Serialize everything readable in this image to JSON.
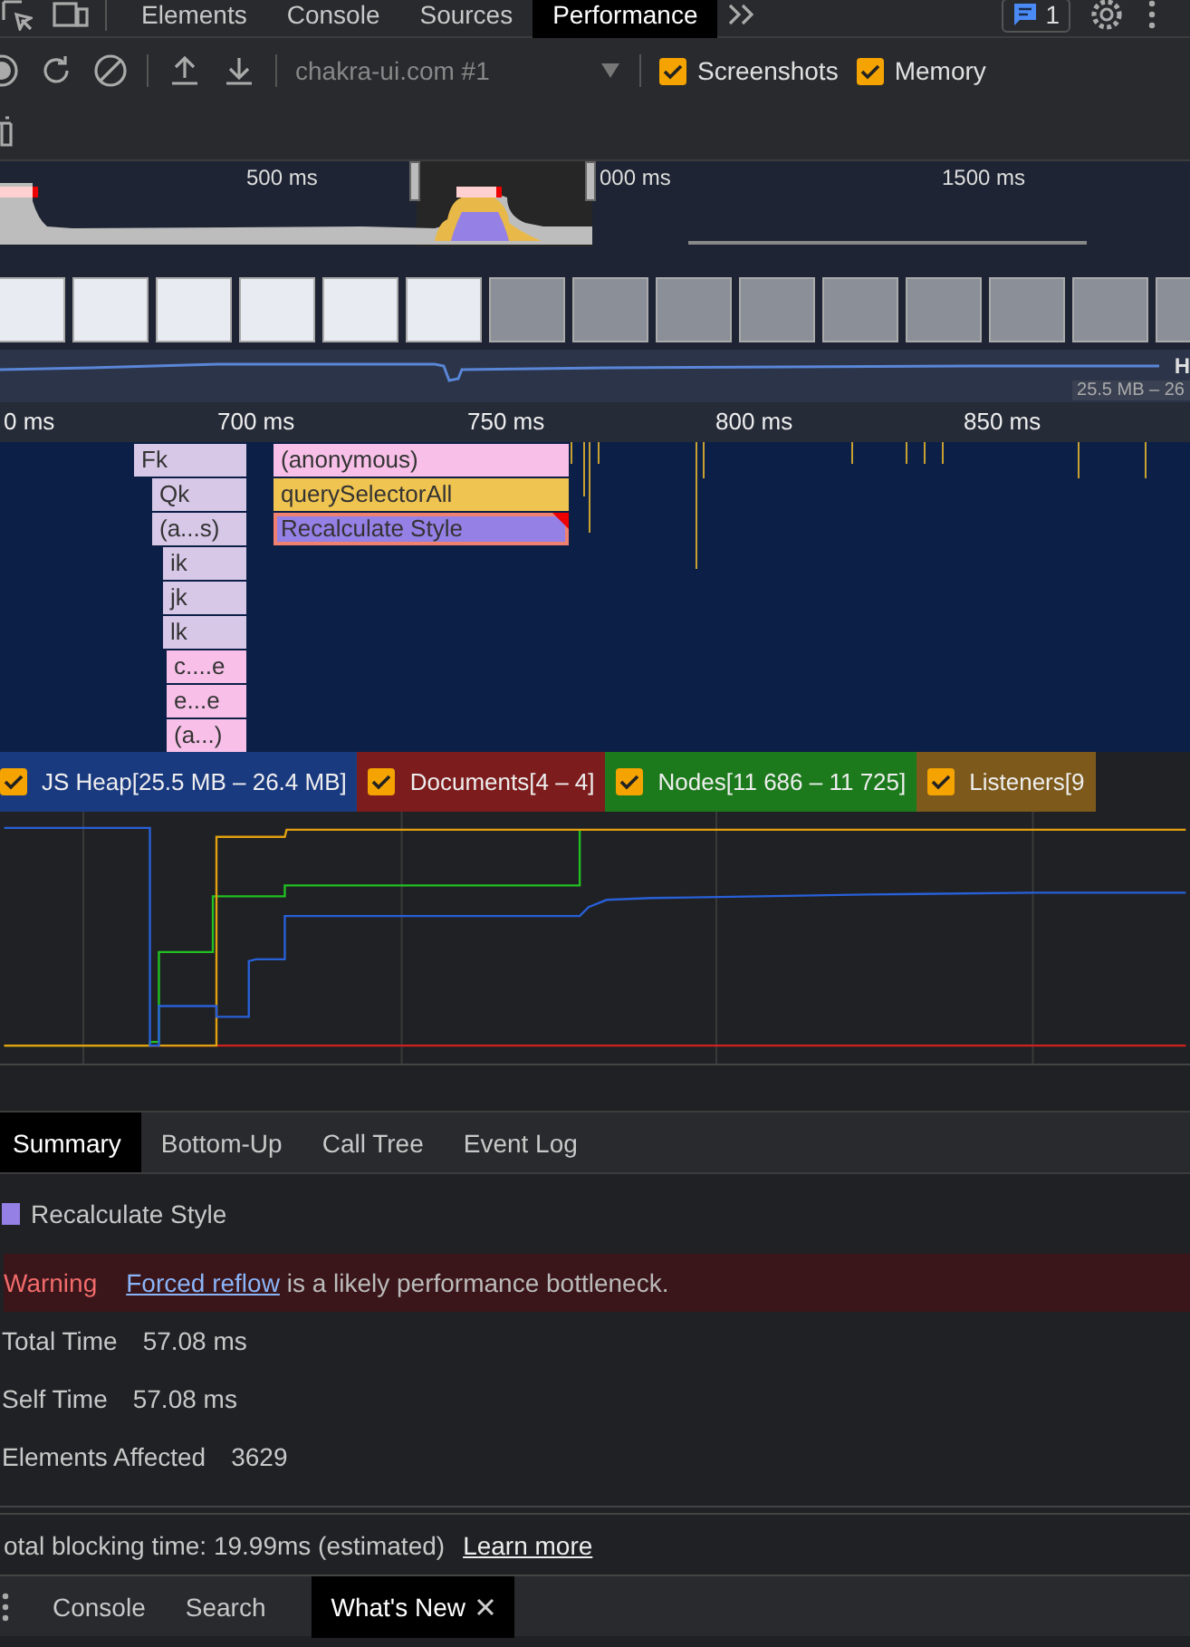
{
  "main_tabs": [
    {
      "label": "Elements",
      "selected": false
    },
    {
      "label": "Console",
      "selected": false
    },
    {
      "label": "Sources",
      "selected": false
    },
    {
      "label": "Performance",
      "selected": true
    }
  ],
  "issues_badge": {
    "count": "1"
  },
  "toolbar": {
    "recording": "chakra-ui.com #1",
    "checkboxes": [
      {
        "label": "Screenshots",
        "checked": true
      },
      {
        "label": "Memory",
        "checked": true
      }
    ]
  },
  "overview": {
    "time_labels": [
      "500 ms",
      "000 ms",
      "1500 ms"
    ]
  },
  "heap_overview": {
    "track_label": "H",
    "range": "25.5 MB – 26"
  },
  "ruler": {
    "labels": [
      "0 ms",
      "700 ms",
      "750 ms",
      "800 ms",
      "850 ms"
    ]
  },
  "flame_chart": {
    "columns": [
      {
        "entries": [
          {
            "label": "Fk",
            "color": "#d8c8e8",
            "selected": false
          },
          {
            "label": "Qk",
            "color": "#d8c8e8",
            "selected": false
          },
          {
            "label": "(a...s)",
            "color": "#d8c8e8",
            "selected": false
          },
          {
            "label": "ik",
            "color": "#d8c8e8",
            "selected": false
          },
          {
            "label": "jk",
            "color": "#d8c8e8",
            "selected": false
          },
          {
            "label": "lk",
            "color": "#d8c8e8",
            "selected": false
          },
          {
            "label": "c....e",
            "color": "#f8c0e8",
            "selected": false
          },
          {
            "label": "e...e",
            "color": "#f8c0e8",
            "selected": false
          },
          {
            "label": "(a...)",
            "color": "#f8c0e8",
            "selected": false
          }
        ]
      },
      {
        "entries": [
          {
            "label": "(anonymous)",
            "color": "#f8c0e8",
            "selected": false
          },
          {
            "label": "querySelectorAll",
            "color": "#f0c450",
            "selected": false
          },
          {
            "label": "Recalculate Style",
            "color": "#9580e6",
            "selected": true
          }
        ]
      }
    ]
  },
  "memory_counters": [
    {
      "label": "JS Heap[25.5 MB – 26.4 MB]",
      "checked": true,
      "color": "#1a3a80"
    },
    {
      "label": "Documents[4 – 4]",
      "checked": true,
      "color": "#7d1c1c"
    },
    {
      "label": "Nodes[11 686 – 11 725]",
      "checked": true,
      "color": "#1c7a1c"
    },
    {
      "label": "Listeners[9",
      "checked": true,
      "color": "#7d5a1c"
    }
  ],
  "detail_tabs": [
    {
      "label": "Summary",
      "selected": true
    },
    {
      "label": "Bottom-Up",
      "selected": false
    },
    {
      "label": "Call Tree",
      "selected": false
    },
    {
      "label": "Event Log",
      "selected": false
    }
  ],
  "summary": {
    "title": "Recalculate Style",
    "warning": {
      "label": "Warning",
      "link": "Forced reflow",
      "text": "is a likely performance bottleneck."
    },
    "rows": [
      {
        "label": "Total Time",
        "value": "57.08 ms"
      },
      {
        "label": "Self Time",
        "value": "57.08 ms"
      },
      {
        "label": "Elements Affected",
        "value": "3629"
      }
    ]
  },
  "status": {
    "text": "otal blocking time: 19.99ms (estimated)",
    "link": "Learn more"
  },
  "drawer_tabs": [
    {
      "label": "Console",
      "selected": false,
      "closable": false
    },
    {
      "label": "Search",
      "selected": false,
      "closable": false
    },
    {
      "label": "What's New",
      "selected": true,
      "closable": true
    }
  ]
}
